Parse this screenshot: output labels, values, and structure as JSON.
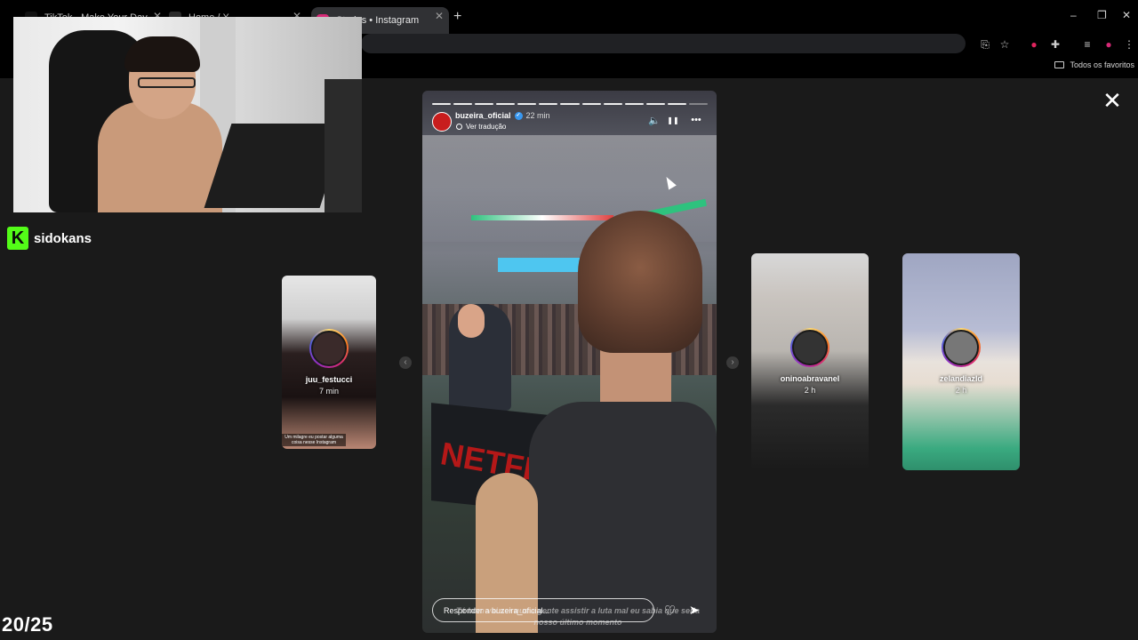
{
  "browser": {
    "tabs": [
      {
        "title": "TikTok - Make Your Day",
        "favicon_color": "#111111"
      },
      {
        "title": "Home / X",
        "favicon_color": "#2a2a2a"
      },
      {
        "title": "Stories • Instagram",
        "favicon_color": "#d62976"
      }
    ],
    "new_tab": "+",
    "window_controls": {
      "minimize": "–",
      "restore": "❐",
      "close": "✕"
    },
    "bookmarks": {
      "folder_label": "Todos os favoritos"
    }
  },
  "stream": {
    "channel_logo": "K",
    "channel_name": "sidokans",
    "counter": "20/25",
    "brand_color": "#53fc18"
  },
  "stories": {
    "close": "✕",
    "prev_arrow": "‹",
    "next_arrow": "›",
    "current": {
      "username": "buzeira_oficial",
      "verified": "✓",
      "time": "22 min",
      "translate": "Ver tradução",
      "controls": {
        "mute": "🔈",
        "pause": "❚❚",
        "more": "•••"
      },
      "progress_total": 13,
      "progress_seen": 12,
      "banner_text": "NETFLIX",
      "reply_placeholder": "Responder a buzeira_oficial...",
      "subtitle": "Tá bom vai ser que a gente assistir a luta mal eu sabia que seria nosso último momento",
      "like_icon": "♡",
      "send_icon": "➤"
    },
    "side": [
      {
        "username": "juu_festucci",
        "time": "7 min",
        "caption": "Um milagre eu postar alguma coisa nesse Instagram"
      },
      {
        "username": "oninoabravanel",
        "time": "2 h"
      },
      {
        "username": "zelandiazld",
        "time": "2 h"
      }
    ]
  }
}
